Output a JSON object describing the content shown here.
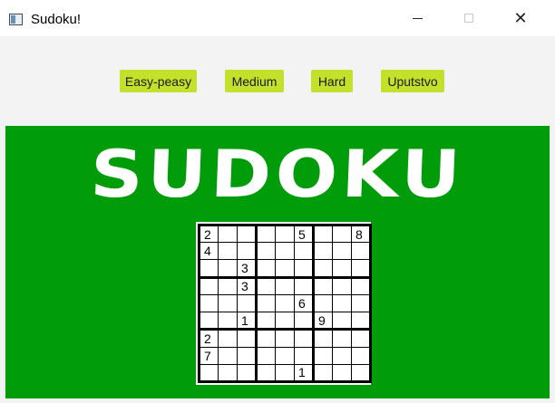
{
  "window": {
    "title": "Sudoku!"
  },
  "toolbar": {
    "buttons": [
      {
        "label": "Easy-peasy"
      },
      {
        "label": "Medium"
      },
      {
        "label": "Hard"
      },
      {
        "label": "Uputstvo"
      }
    ]
  },
  "main": {
    "logo": "SUDOKU"
  },
  "board": {
    "rows": [
      [
        "2",
        "",
        "",
        "",
        "",
        "5",
        "",
        "",
        "8"
      ],
      [
        "4",
        "",
        "",
        "",
        "",
        "",
        "",
        "",
        ""
      ],
      [
        "",
        "",
        "3",
        "",
        "",
        "",
        "",
        "",
        ""
      ],
      [
        "",
        "",
        "3",
        "",
        "",
        "",
        "",
        "",
        ""
      ],
      [
        "",
        "",
        "",
        "",
        "",
        "6",
        "",
        "",
        ""
      ],
      [
        "",
        "",
        "1",
        "",
        "",
        "",
        "9",
        "",
        ""
      ],
      [
        "2",
        "",
        "",
        "",
        "",
        "",
        "",
        "",
        ""
      ],
      [
        "7",
        "",
        "",
        "",
        "",
        "",
        "",
        "",
        ""
      ],
      [
        "",
        "",
        "",
        "",
        "",
        "1",
        "",
        "",
        ""
      ]
    ]
  },
  "colors": {
    "main_bg": "#009c0a",
    "button_bg": "#c3e12b",
    "toolbar_bg": "#f3f3f3"
  },
  "icons": {
    "app": "sudoku-app-icon",
    "minimize": "minimize-icon",
    "maximize": "maximize-icon",
    "close": "close-icon"
  }
}
